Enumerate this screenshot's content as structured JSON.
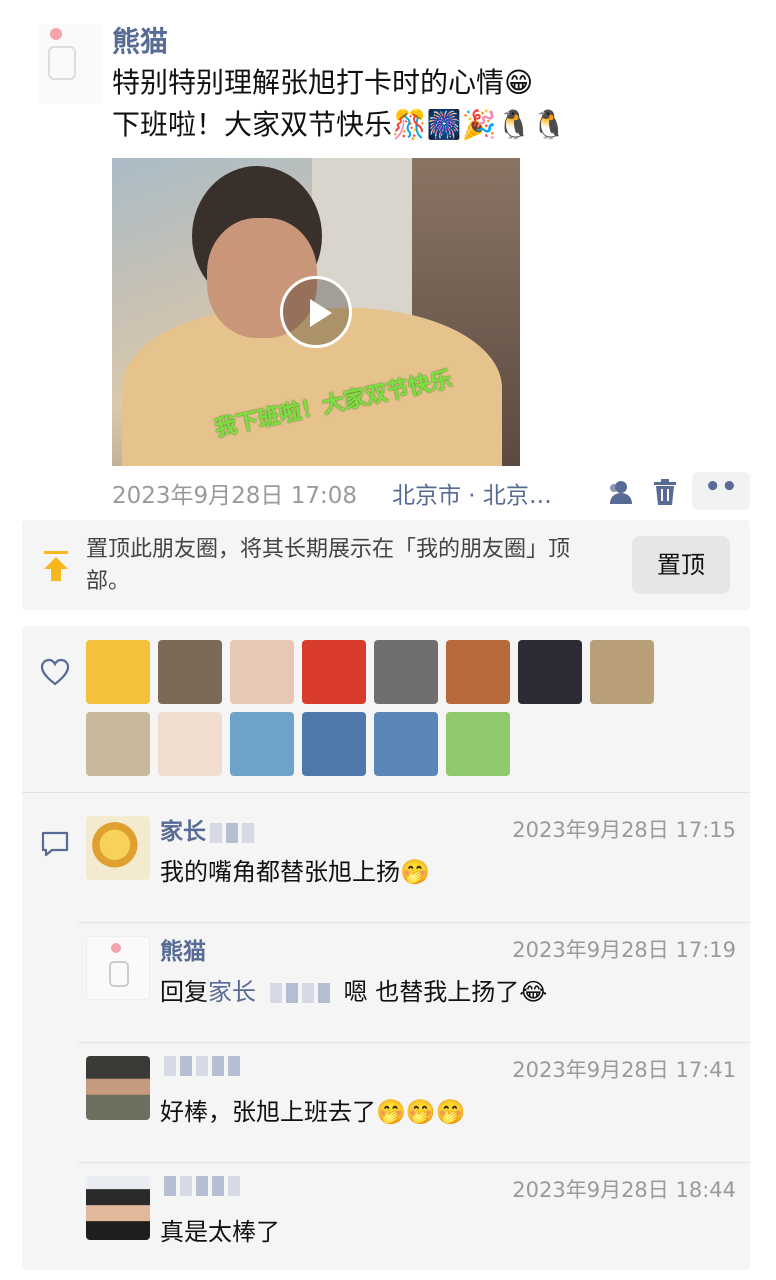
{
  "post": {
    "author": "熊猫",
    "line1": "特别特别理解张旭打卡时的心情",
    "line1_emoji": "😁",
    "line2": "下班啦！大家双节快乐",
    "line2_emoji": "🎊🎆🎉🐧🐧",
    "video_caption": "我下班啦！大家双节快乐",
    "time": "2023年9月28日 17:08",
    "location": "北京市 · 北京…",
    "more_label": "••"
  },
  "pin_bar": {
    "text": "置顶此朋友圈，将其长期展示在「我的朋友圈」顶部。",
    "button": "置顶"
  },
  "likes": {
    "avatar_colors": [
      "#f3c13a",
      "#7b6a55",
      "#e9c7b7",
      "#d93c2c",
      "#6f6f6f",
      "#b86a3c",
      "#2b2b35",
      "#b89f78",
      "#c9b89c",
      "#f1ddd0",
      "#6ea2c8",
      "#4f79a8",
      "#5a87b8",
      "#8fc96c"
    ]
  },
  "comments": [
    {
      "name": "家长",
      "time": "2023年9月28日 17:15",
      "text": "我的嘴角都替张旭上扬",
      "emoji": "🤭",
      "avatar_color": "#f0c845"
    },
    {
      "name": "熊猫",
      "time": "2023年9月28日 17:19",
      "reply_prefix": "回复",
      "reply_to": "家长",
      "text": "嗯  也替我上扬了",
      "emoji": "😂",
      "avatar_color": "#fafafa"
    },
    {
      "name": "",
      "time": "2023年9月28日 17:41",
      "text": "好棒，张旭上班去了",
      "emoji": "🤭🤭🤭",
      "avatar_color": "#6b6e63"
    },
    {
      "name": "",
      "time": "2023年9月28日 18:44",
      "text": "真是太棒了",
      "emoji": "",
      "avatar_color": "#dfe3ea"
    }
  ]
}
